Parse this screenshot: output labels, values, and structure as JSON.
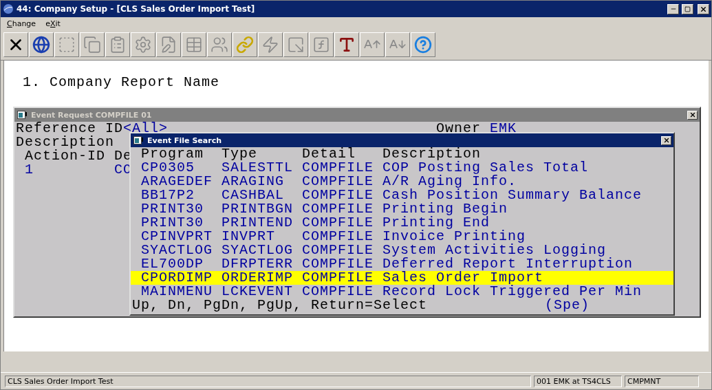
{
  "window": {
    "title": "44: Company Setup - [CLS Sales Order Import Test]"
  },
  "menu": [
    {
      "accel": "C",
      "rest": "hange"
    },
    {
      "lead": "e",
      "accel": "X",
      "rest": "it"
    }
  ],
  "toolbar": [
    {
      "kind": "close",
      "disabled": false
    },
    {
      "kind": "globe",
      "disabled": false
    },
    {
      "kind": "select",
      "disabled": true
    },
    {
      "kind": "copy",
      "disabled": true
    },
    {
      "kind": "paste",
      "disabled": true
    },
    {
      "kind": "settings",
      "disabled": true
    },
    {
      "kind": "edit",
      "disabled": true
    },
    {
      "kind": "list",
      "disabled": true
    },
    {
      "kind": "users",
      "disabled": true
    },
    {
      "kind": "link",
      "disabled": false
    },
    {
      "kind": "lightning",
      "disabled": true
    },
    {
      "kind": "window",
      "disabled": true
    },
    {
      "kind": "function",
      "disabled": true
    },
    {
      "kind": "font",
      "disabled": false
    },
    {
      "kind": "grow",
      "disabled": true
    },
    {
      "kind": "shrink",
      "disabled": true
    },
    {
      "kind": "help",
      "disabled": false
    }
  ],
  "screen": {
    "line_1": "1. Company Report Name"
  },
  "event_request": {
    "title": "Event Request COMPFILE 01",
    "reference_label": "Reference ID",
    "reference_value": "<All>",
    "owner_label": "Owner",
    "owner_value": "EMK",
    "description_label": "Description",
    "columns": [
      "Action-ID",
      "De"
    ],
    "rows": [
      [
        "1",
        "CO"
      ]
    ]
  },
  "event_search": {
    "title": "Event File Search",
    "columns": [
      "Program",
      "Type",
      "Detail",
      "Description"
    ],
    "rows": [
      {
        "cells": [
          "CP0305",
          "SALESTTL",
          "COMPFILE",
          "COP Posting Sales Total"
        ],
        "selected": false
      },
      {
        "cells": [
          "ARAGEDEF",
          "ARAGING",
          "COMPFILE",
          "A/R Aging Info."
        ],
        "selected": false
      },
      {
        "cells": [
          "BB17P2",
          "CASHBAL",
          "COMPFILE",
          "Cash Position Summary Balance"
        ],
        "selected": false
      },
      {
        "cells": [
          "PRINT30",
          "PRINTBGN",
          "COMPFILE",
          "Printing Begin"
        ],
        "selected": false
      },
      {
        "cells": [
          "PRINT30",
          "PRINTEND",
          "COMPFILE",
          "Printing End"
        ],
        "selected": false
      },
      {
        "cells": [
          "CPINVPRT",
          "INVPRT",
          "COMPFILE",
          "Invoice Printing"
        ],
        "selected": false
      },
      {
        "cells": [
          "SYACTLOG",
          "SYACTLOG",
          "COMPFILE",
          "System Activities Logging"
        ],
        "selected": false
      },
      {
        "cells": [
          "EL700DP",
          "DFRPTERR",
          "COMPFILE",
          "Deferred Report Interruption"
        ],
        "selected": false
      },
      {
        "cells": [
          "CPORDIMP",
          "ORDERIMP",
          "COMPFILE",
          "Sales Order Import"
        ],
        "selected": true
      },
      {
        "cells": [
          "MAINMENU",
          "LCKEVENT",
          "COMPFILE",
          "Record Lock Triggered Per Min"
        ],
        "selected": false
      }
    ],
    "hint": "Up, Dn, PgDn, PgUp, Return=Select",
    "hint_extra": "(Spe)"
  },
  "status_bar": [
    "CLS Sales Order Import Test",
    "001 EMK at TS4CLS",
    "CMPMNT"
  ]
}
